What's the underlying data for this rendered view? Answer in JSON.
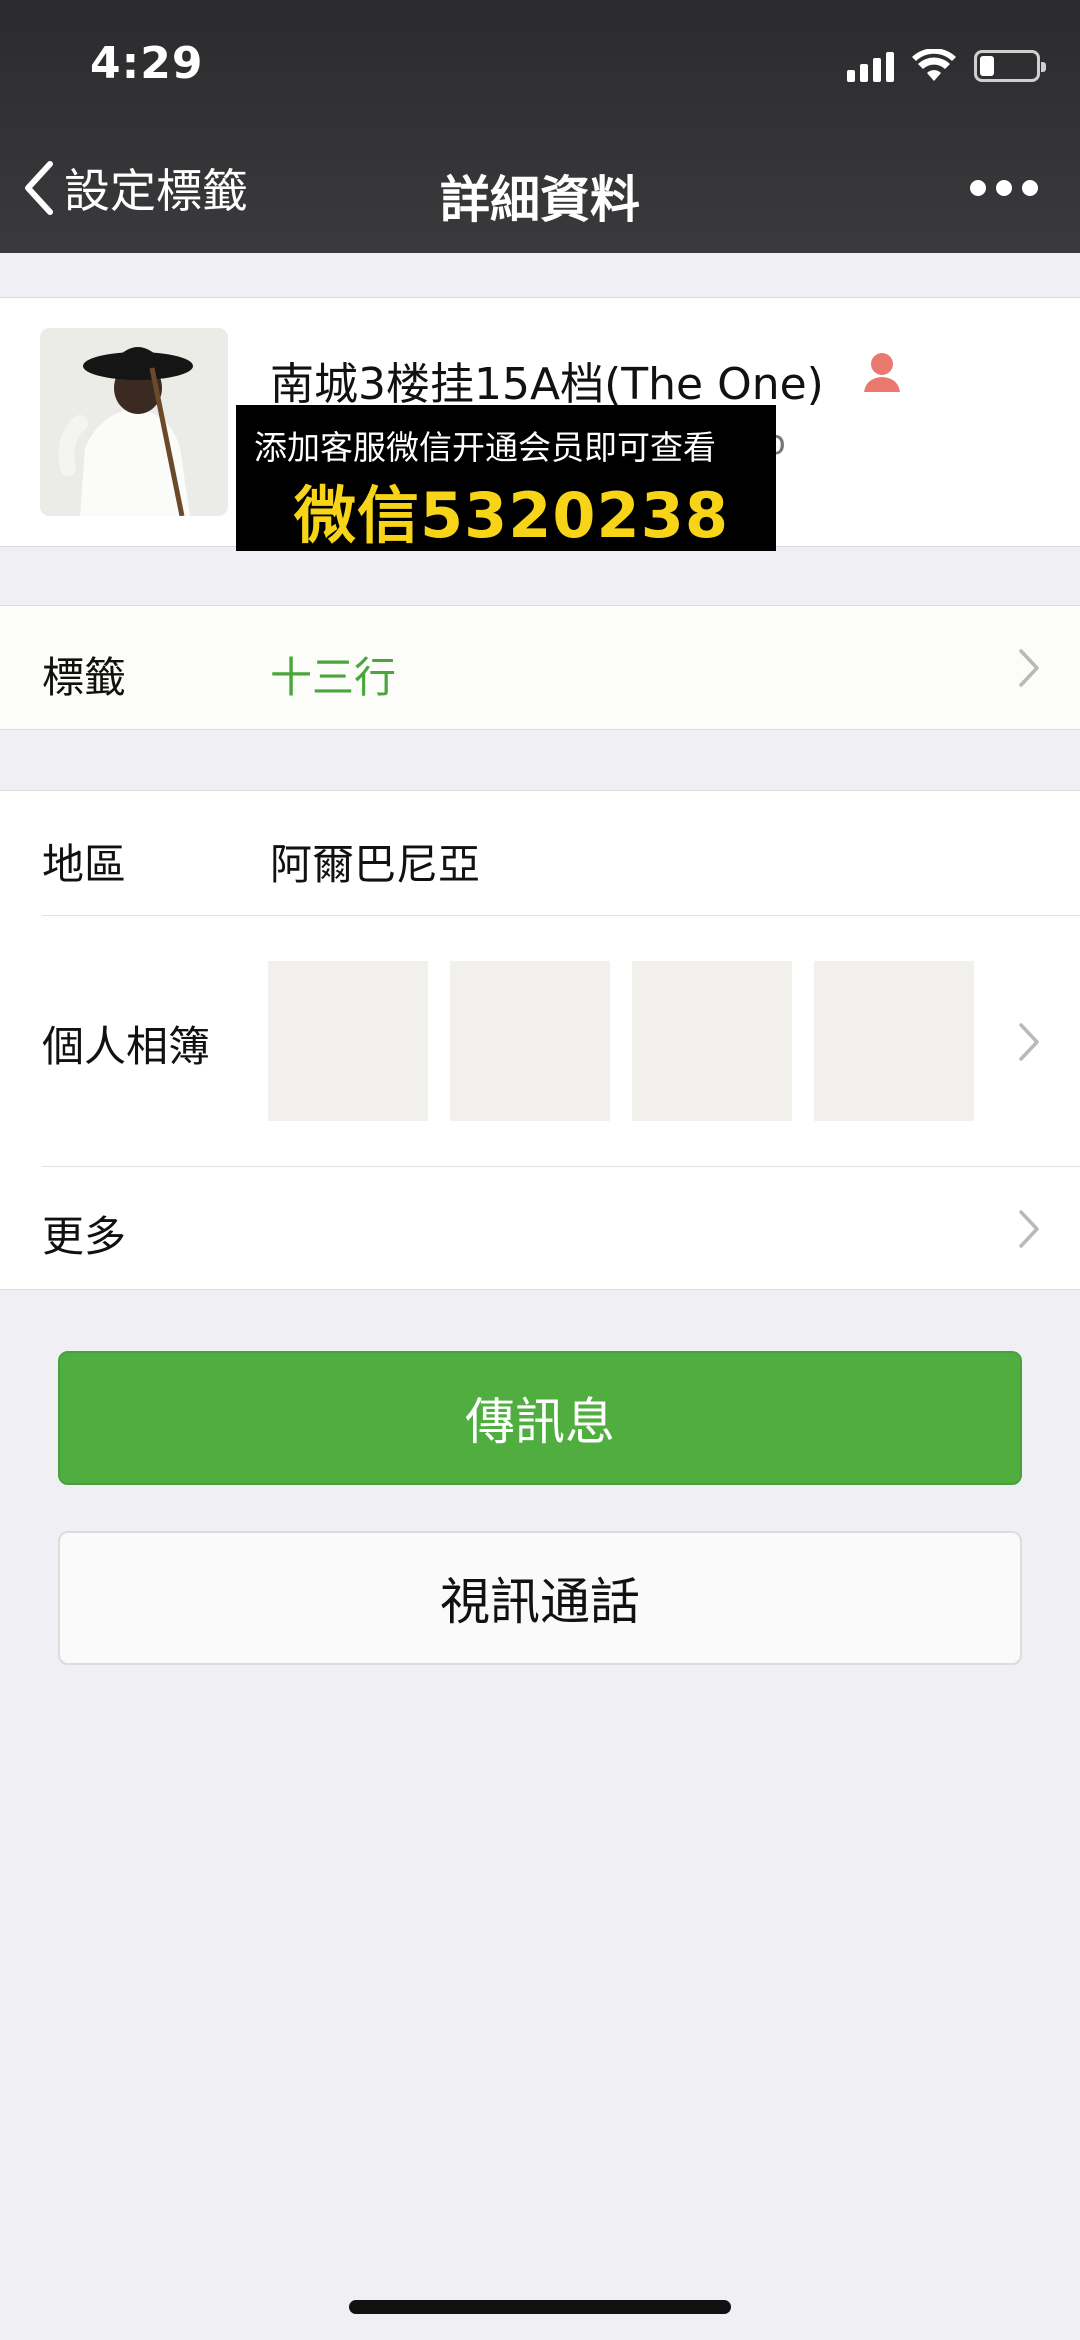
{
  "status": {
    "time": "4:29"
  },
  "nav": {
    "back_label": "設定標籤",
    "title": "詳細資料",
    "more_icon": "more-icon"
  },
  "profile": {
    "name": "南城3楼挂15A档(The  One)",
    "subline_visible_fragment": "o",
    "gender_icon": "female-user-icon"
  },
  "overlay": {
    "line1": "添加客服微信开通会员即可查看",
    "line2": "微信5320238"
  },
  "tags": {
    "label": "標籤",
    "value": "十三行"
  },
  "region": {
    "label": "地區",
    "value": "阿爾巴尼亞"
  },
  "album": {
    "label": "個人相簿",
    "thumb_count": 4
  },
  "more": {
    "label": "更多"
  },
  "actions": {
    "send_message": "傳訊息",
    "video_call": "視訊通話"
  },
  "colors": {
    "nav_bg": "#2f2f31",
    "accent_green": "#4fae3f",
    "tag_green": "#4aa63c",
    "overlay_text": "#f7d417",
    "page_bg": "#efeff4"
  }
}
